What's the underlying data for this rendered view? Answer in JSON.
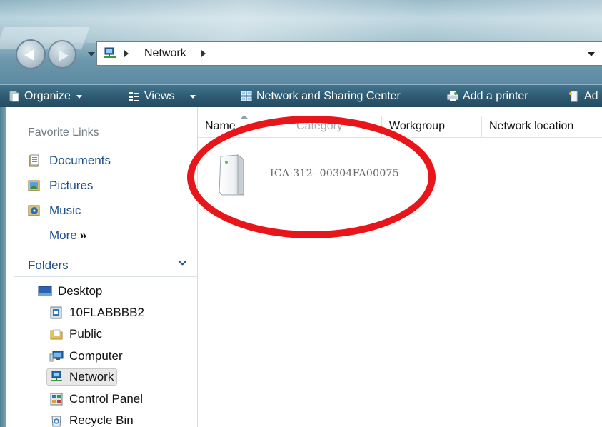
{
  "address_bar": {
    "location": "Network"
  },
  "toolbar": {
    "organize": "Organize",
    "views": "Views",
    "network_sharing": "Network and Sharing Center",
    "add_printer": "Add a printer",
    "truncated": "Ad"
  },
  "nav": {
    "favorites_title": "Favorite Links",
    "favorites": [
      {
        "label": "Documents",
        "icon": "documents-icon"
      },
      {
        "label": "Pictures",
        "icon": "pictures-icon"
      },
      {
        "label": "Music",
        "icon": "music-icon"
      }
    ],
    "more_label": "More",
    "more_glyph": "»",
    "folders_label": "Folders",
    "tree": [
      {
        "label": "Desktop",
        "icon": "desktop-icon"
      },
      {
        "label": "10FLABBBB2",
        "icon": "user-folder-icon"
      },
      {
        "label": "Public",
        "icon": "folder-icon"
      },
      {
        "label": "Computer",
        "icon": "computer-icon"
      },
      {
        "label": "Network",
        "icon": "network-icon",
        "selected": true
      },
      {
        "label": "Control Panel",
        "icon": "control-panel-icon"
      },
      {
        "label": "Recycle Bin",
        "icon": "recycle-bin-icon"
      }
    ]
  },
  "columns": [
    "Name",
    "Category",
    "Workgroup",
    "Network location"
  ],
  "items": [
    {
      "name": "ICA-312- 00304FA00075",
      "icon": "network-device-icon"
    }
  ],
  "colors": {
    "toolbar_bg": "#2f5b73",
    "link_blue": "#1d4e8f",
    "highlight_red": "#e8161b"
  }
}
